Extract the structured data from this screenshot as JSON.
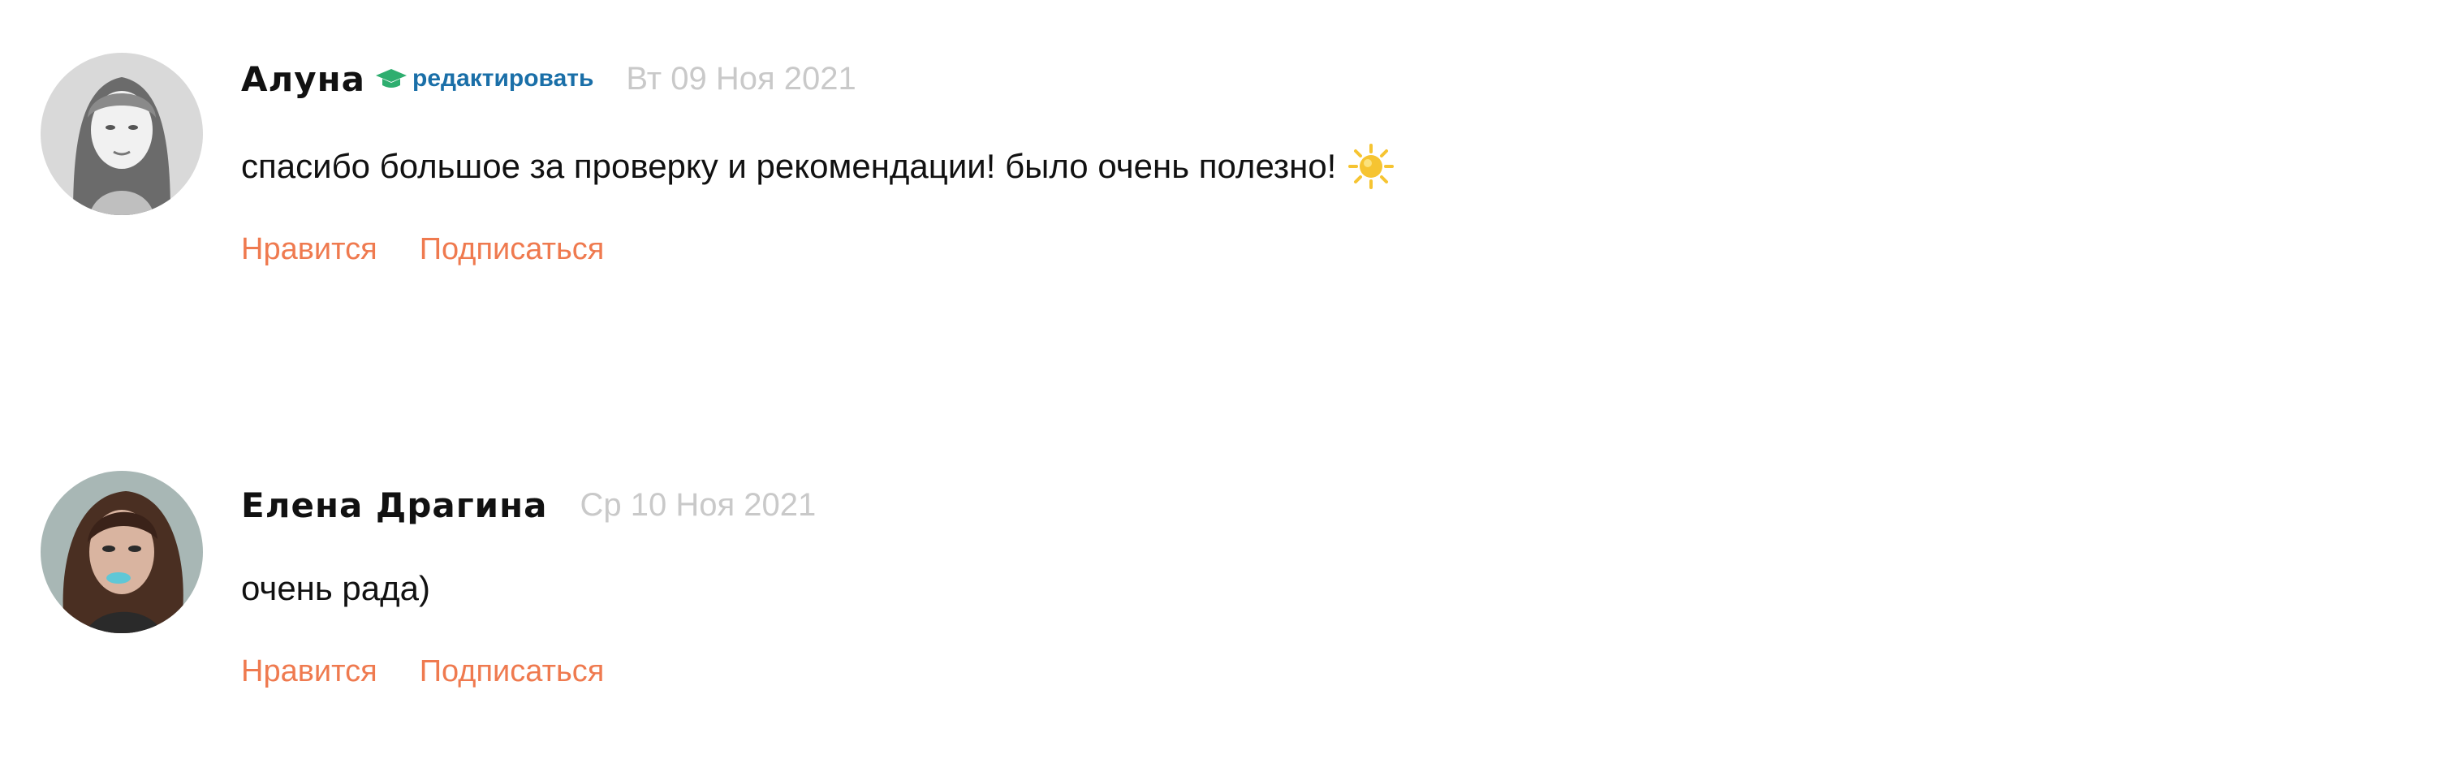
{
  "comments": [
    {
      "author": "Алуна",
      "badge_icon": "graduation-cap-icon",
      "edit_label": "редактировать",
      "date": "Вт 09 Ноя 2021",
      "text": "спасибо большое за проверку и рекомендации! было очень полезно!",
      "emoji": "sun-icon",
      "like_label": "Нравится",
      "subscribe_label": "Подписаться"
    },
    {
      "author": "Елена Драгина",
      "date": "Ср 10 Ноя 2021",
      "text": "очень рада)",
      "like_label": "Нравится",
      "subscribe_label": "Подписаться"
    }
  ],
  "colors": {
    "action_link": "#ef7a4f",
    "edit_link": "#1a6fa8",
    "badge_green": "#2eae6f",
    "date_gray": "#c9c9c9",
    "sun_yellow": "#f6c431"
  }
}
